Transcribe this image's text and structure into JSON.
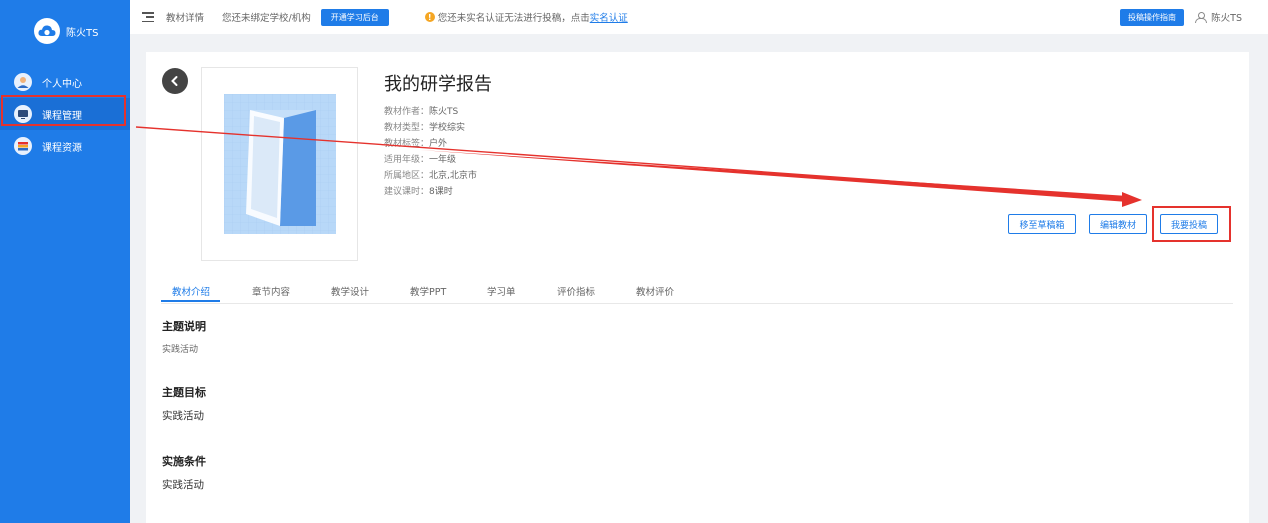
{
  "sidebar": {
    "brand_name": "陈火TS",
    "items": [
      {
        "label": "个人中心",
        "icon": "avatar-icon"
      },
      {
        "label": "课程管理",
        "icon": "monitor-icon"
      },
      {
        "label": "课程资源",
        "icon": "book-stack-icon"
      }
    ]
  },
  "topbar": {
    "breadcrumb": "教材详情",
    "bind_tip": "您还未绑定学校/机构",
    "open_button": "开通学习后台",
    "warning_text": "您还未实名认证无法进行投稿，点击",
    "warning_link": "实名认证",
    "guide_button": "投稿操作指南",
    "username": "陈火TS"
  },
  "material": {
    "title": "我的研学报告",
    "meta": [
      {
        "label": "教材作者：",
        "value": "陈火TS"
      },
      {
        "label": "教材类型：",
        "value": "学校综实"
      },
      {
        "label": "教材标签：",
        "value": "户外"
      },
      {
        "label": "适用年级：",
        "value": "一年级"
      },
      {
        "label": "所属地区：",
        "value": "北京,北京市"
      },
      {
        "label": "建议课时：",
        "value": "8课时"
      }
    ]
  },
  "actions": {
    "move_draft": "移至草稿箱",
    "edit": "编辑教材",
    "submit": "我要投稿"
  },
  "tabs": [
    "教材介绍",
    "章节内容",
    "教学设计",
    "教学PPT",
    "学习单",
    "评价指标",
    "教材评价"
  ],
  "sections": [
    {
      "title": "主题说明",
      "text": "实践活动"
    },
    {
      "title": "主题目标",
      "text": "实践活动"
    },
    {
      "title": "实施条件",
      "text": "实践活动"
    }
  ],
  "colors": {
    "primary": "#1f7ce8",
    "annotation_red": "#e5322d",
    "warning": "#f5a623"
  }
}
